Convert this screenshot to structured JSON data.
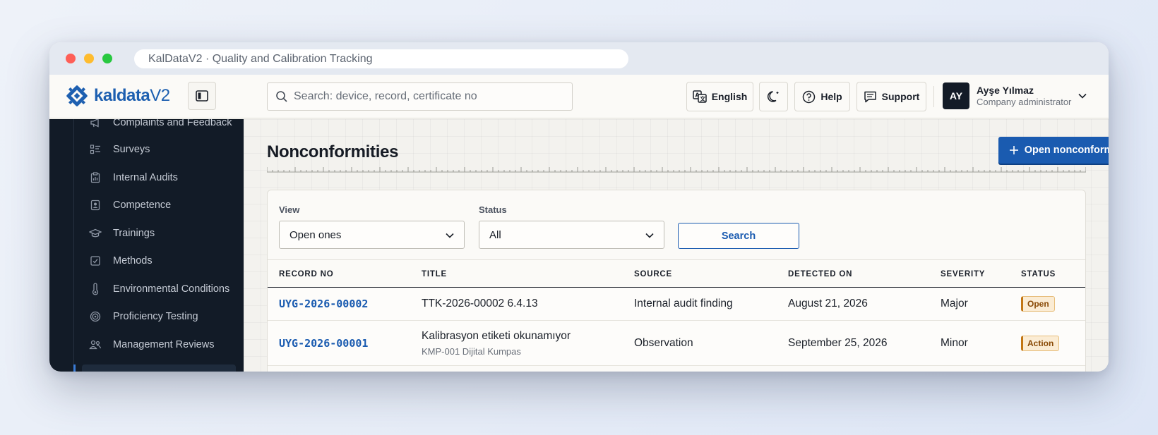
{
  "window": {
    "url_title": "KalDataV2 · Quality and Calibration Tracking"
  },
  "header": {
    "logo_main": "kaldata",
    "logo_suffix": "V2",
    "search_placeholder": "Search: device, record, certificate no",
    "language_label": "English",
    "help_label": "Help",
    "support_label": "Support",
    "user": {
      "initials": "AY",
      "name": "Ayşe Yılmaz",
      "role": "Company administrator"
    }
  },
  "sidebar": {
    "items": [
      {
        "label": "Complaints and Feedback",
        "icon": "megaphone-icon"
      },
      {
        "label": "Surveys",
        "icon": "checklist-icon"
      },
      {
        "label": "Internal Audits",
        "icon": "clipboard-chart-icon"
      },
      {
        "label": "Competence",
        "icon": "id-badge-icon"
      },
      {
        "label": "Trainings",
        "icon": "graduation-cap-icon"
      },
      {
        "label": "Methods",
        "icon": "check-square-icon"
      },
      {
        "label": "Environmental Conditions",
        "icon": "thermometer-icon"
      },
      {
        "label": "Proficiency Testing",
        "icon": "target-icon"
      },
      {
        "label": "Management Reviews",
        "icon": "users-icon"
      }
    ]
  },
  "main": {
    "title": "Nonconformities",
    "open_button": "Open nonconformity",
    "filters": {
      "view_label": "View",
      "view_value": "Open ones",
      "status_label": "Status",
      "status_value": "All",
      "search_button": "Search"
    },
    "table": {
      "columns": [
        "RECORD NO",
        "TITLE",
        "SOURCE",
        "DETECTED ON",
        "SEVERITY",
        "STATUS"
      ],
      "rows": [
        {
          "record_no": "UYG-2026-00002",
          "title": "TTK-2026-00002 6.4.13",
          "subtitle": "",
          "source": "Internal audit finding",
          "detected_on": "August 21, 2026",
          "severity": "Major",
          "status": "Open"
        },
        {
          "record_no": "UYG-2026-00001",
          "title": "Kalibrasyon etiketi okunamıyor",
          "subtitle": "KMP-001 Dijital Kumpas",
          "source": "Observation",
          "detected_on": "September 25, 2026",
          "severity": "Minor",
          "status": "Action"
        }
      ]
    }
  },
  "colors": {
    "accent": "#1a5bb0",
    "sidebar_bg": "#121b27",
    "badge_bg": "#fbecd4",
    "badge_text": "#8a4a06"
  }
}
